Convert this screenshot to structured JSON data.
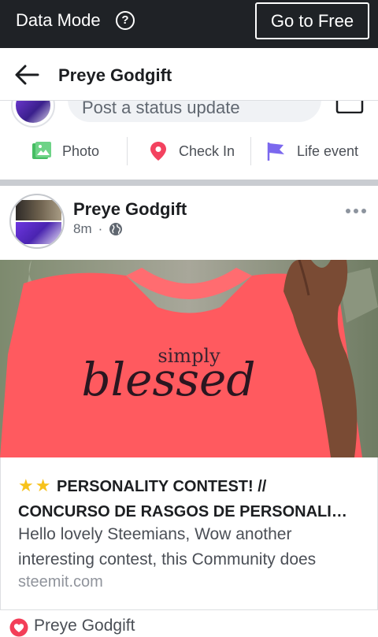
{
  "data_mode_bar": {
    "title": "Data Mode",
    "help_icon": "question-circle-icon",
    "go_free_label": "Go to Free"
  },
  "header": {
    "back_icon": "back-arrow-icon",
    "title": "Preye Godgift"
  },
  "composer": {
    "placeholder": "Post a status update",
    "camera_icon": "camera-icon",
    "actions": [
      {
        "label": "Photo",
        "icon": "photo-icon",
        "color": "#45bd62"
      },
      {
        "label": "Check In",
        "icon": "location-pin-icon",
        "color": "#f3425f"
      },
      {
        "label": "Life event",
        "icon": "flag-icon",
        "color": "#7b68ee"
      }
    ]
  },
  "post": {
    "author": "Preye Godgift",
    "time": "8m",
    "separator": "·",
    "privacy_icon": "globe-icon",
    "more_icon": "more-dots-icon",
    "image_text_small": "simply",
    "image_text_large": "blessed",
    "link": {
      "title_line1": "PERSONALITY CONTEST! //",
      "title_line2": "CONCURSO DE RASGOS DE PERSONALIDAD",
      "description_line1": "Hello lovely Steemians, Wow another",
      "description_line2": "interesting contest, this Community does",
      "domain": "steemit.com"
    }
  },
  "reactions": {
    "icon": "heart-reaction-icon",
    "names": "Preye Godgift"
  },
  "colors": {
    "data_bar": "#1f2226",
    "shirt": "#ff5a5f",
    "accent_blue": "#1877f2"
  }
}
